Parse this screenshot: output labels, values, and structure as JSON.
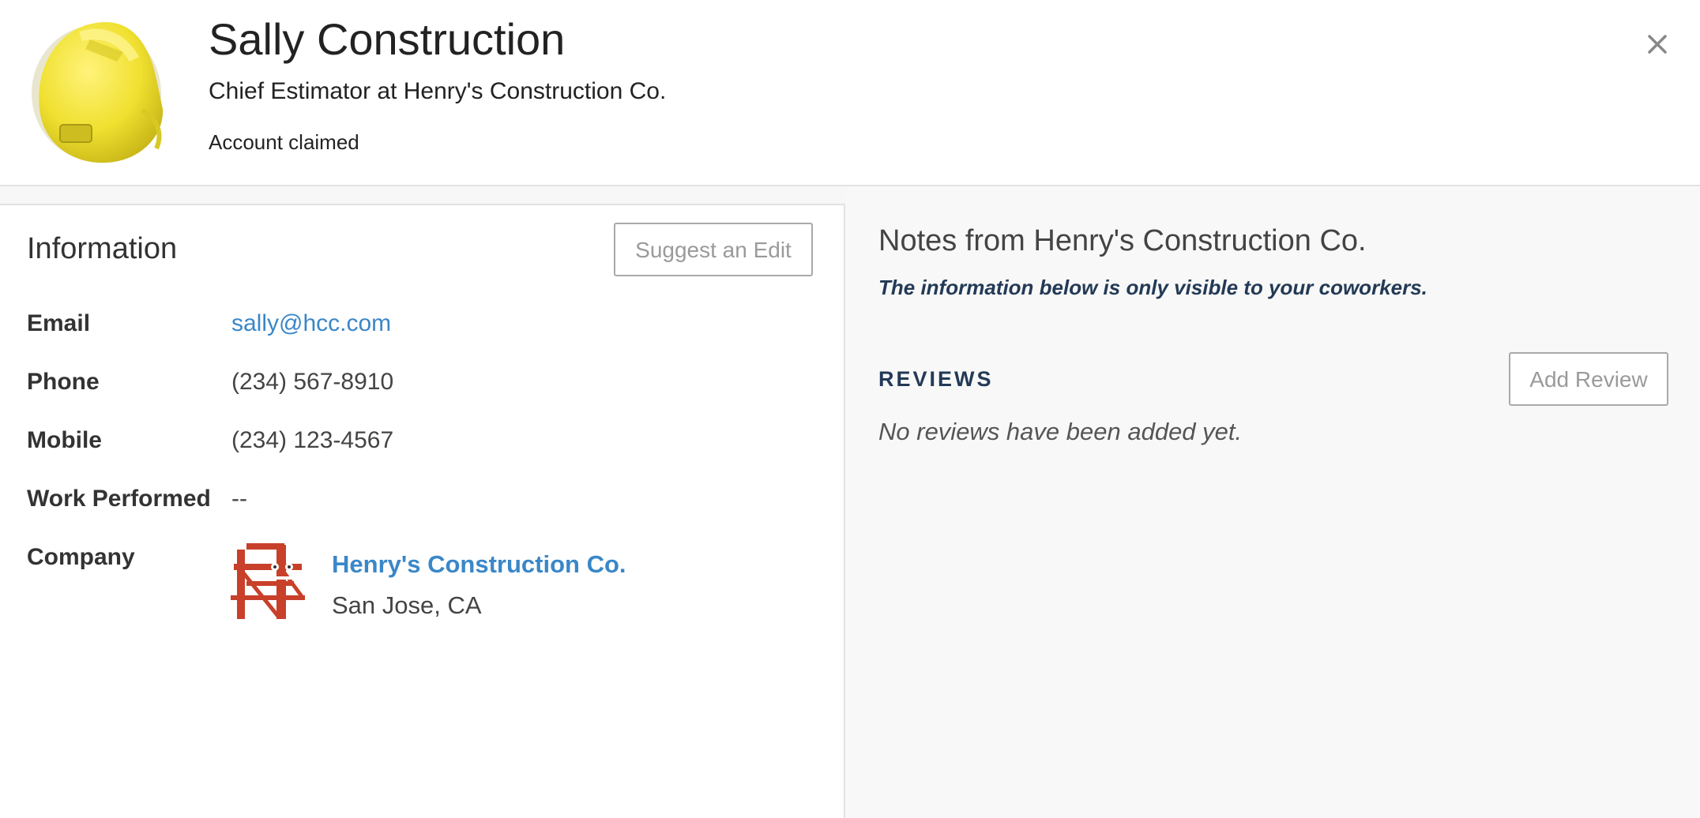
{
  "profile": {
    "name": "Sally Construction",
    "title": "Chief Estimator at Henry's Construction Co.",
    "status": "Account claimed",
    "avatar_icon": "hard-hat-icon",
    "close_icon": "close-icon"
  },
  "information": {
    "heading": "Information",
    "suggest_edit_label": "Suggest an Edit",
    "email_label": "Email",
    "email_value": "sally@hcc.com",
    "phone_label": "Phone",
    "phone_value": "(234) 567-8910",
    "mobile_label": "Mobile",
    "mobile_value": "(234) 123-4567",
    "work_label": "Work Performed",
    "work_value": "--",
    "company_label": "Company",
    "company_name": "Henry's Construction Co.",
    "company_location": "San Jose, CA",
    "company_logo_icon": "bridge-logo-icon"
  },
  "notes": {
    "heading": "Notes from Henry's Construction Co.",
    "subtitle": "The information below is only visible to your coworkers.",
    "reviews_heading": "REVIEWS",
    "add_review_label": "Add Review",
    "no_reviews_text": "No reviews have been added yet."
  },
  "colors": {
    "link": "#3a87c8",
    "navy_text": "#233a56",
    "right_panel_bg": "#f8f8f8",
    "hat_yellow": "#f2e43a",
    "logo_red": "#c8402a"
  }
}
